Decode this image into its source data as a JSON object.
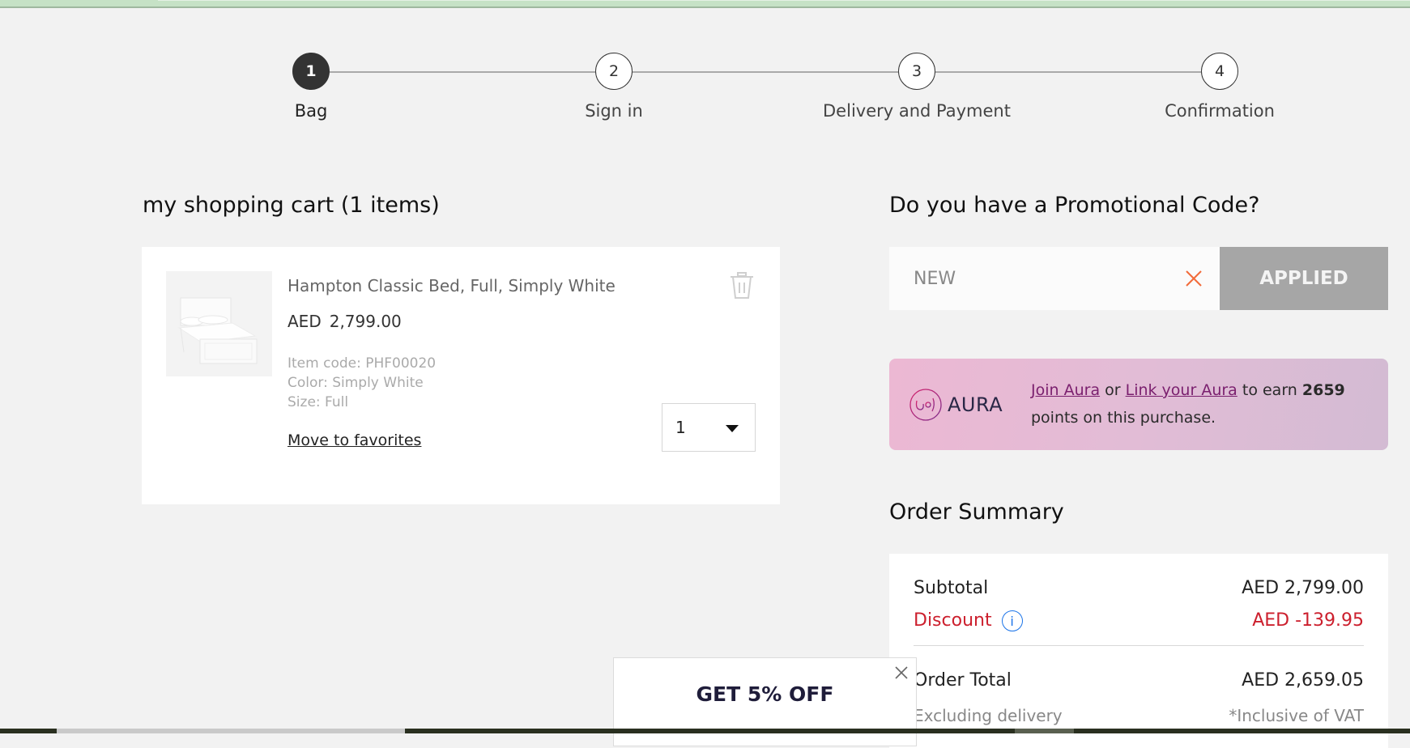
{
  "stepper": {
    "steps": [
      {
        "number": "1",
        "label": "Bag",
        "active": true
      },
      {
        "number": "2",
        "label": "Sign in",
        "active": false
      },
      {
        "number": "3",
        "label": "Delivery and Payment",
        "active": false
      },
      {
        "number": "4",
        "label": "Confirmation",
        "active": false
      }
    ]
  },
  "cart": {
    "title": "my shopping cart (1 items)",
    "items": [
      {
        "name": "Hampton Classic Bed, Full, Simply White",
        "currency": "AED",
        "price": "2,799.00",
        "item_code": "Item code: PHF00020",
        "color": "Color: Simply White",
        "size": "Size: Full",
        "move_to_favorites": "Move to favorites",
        "quantity": "1"
      }
    ]
  },
  "promo": {
    "title": "Do you have a Promotional Code?",
    "code_value": "NEW",
    "button_label": "APPLIED",
    "clear_icon_color": "#f26b3a"
  },
  "aura": {
    "logo_text": "AURA",
    "join_link": "Join Aura",
    "or_text": " or ",
    "link_link": "Link your Aura",
    "earn_text": " to earn ",
    "points": "2659",
    "suffix_text": " points on this purchase."
  },
  "summary": {
    "title": "Order Summary",
    "subtotal_label": "Subtotal",
    "subtotal_value": "AED 2,799.00",
    "discount_label": "Discount",
    "discount_value": "AED -139.95",
    "total_label": "Order Total",
    "total_value": "AED 2,659.05",
    "delivery_note": "Excluding delivery",
    "vat_note": "*Inclusive of VAT",
    "discount_color": "#cc1f2d"
  },
  "popup": {
    "text": "GET 5% OFF"
  }
}
